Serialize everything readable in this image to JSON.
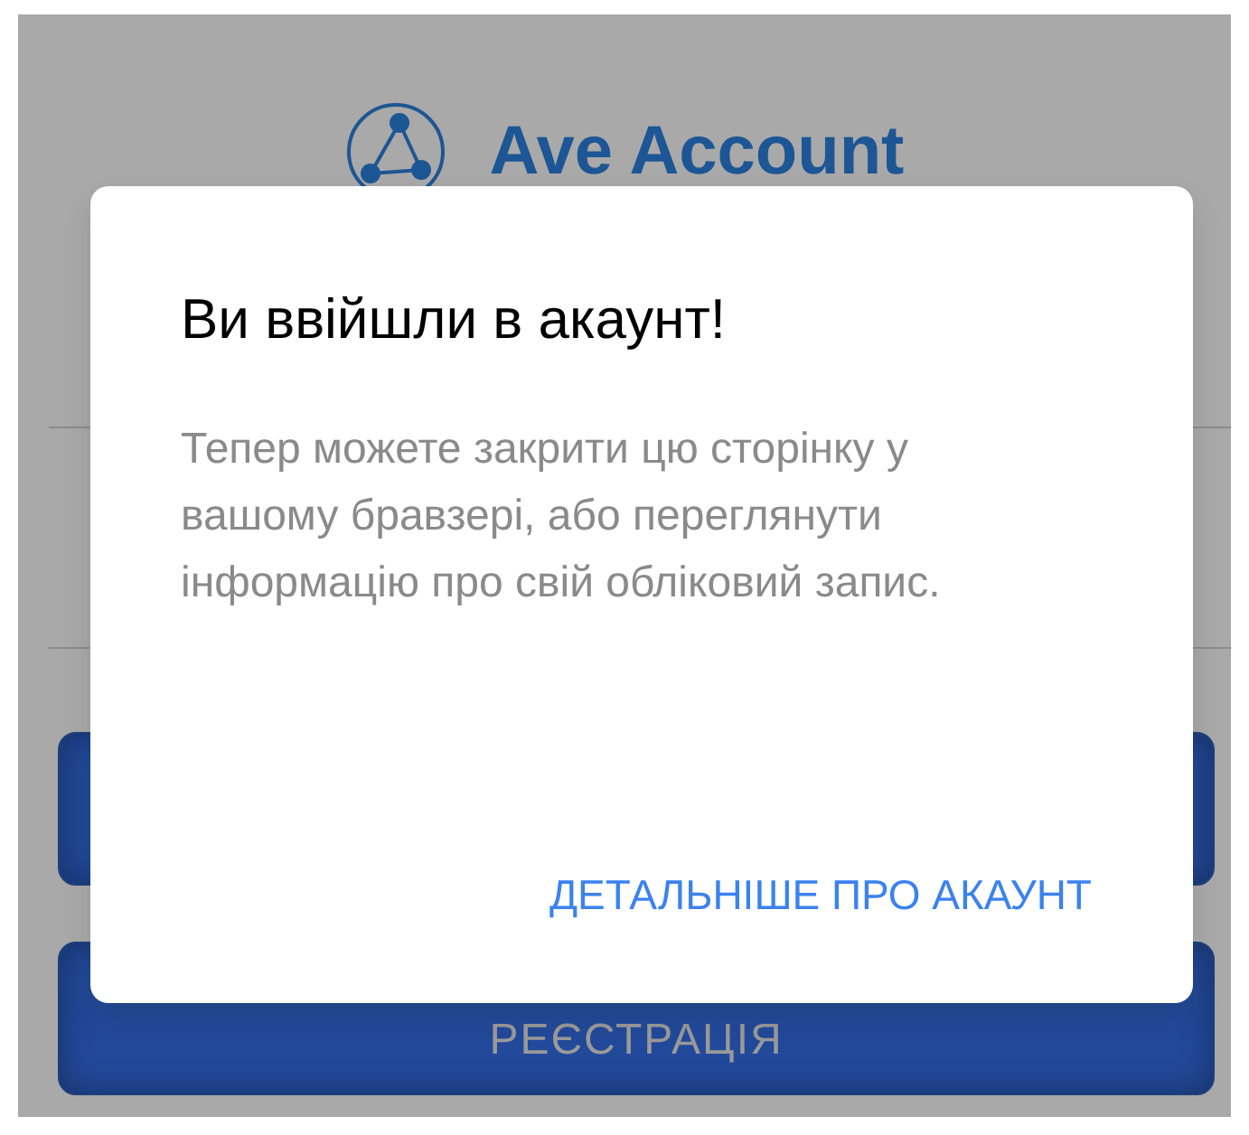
{
  "app": {
    "title": "Ave Account",
    "register_button": "РЕЄСТРАЦІЯ"
  },
  "dialog": {
    "title": "Ви ввійшли в акаунт!",
    "message": "Тепер можете закрити цю сторінку у вашому бравзері, або переглянути інформацію про свій обліковий запис.",
    "action": "ДЕТАЛЬНІШЕ ПРО АКАУНТ"
  }
}
